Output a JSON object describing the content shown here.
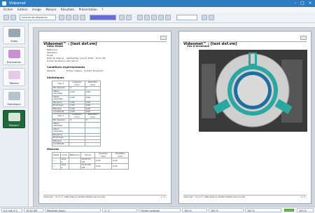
{
  "window": {
    "title": "Videomet"
  },
  "menu": [
    "Fichier",
    "Edition",
    "Image",
    "Mesure",
    "Résultats",
    "Présentation",
    "?"
  ],
  "toolbar": {
    "dropdown_left": "Lecture de séquence",
    "dropdown_mid": "",
    "dropdown_right": ""
  },
  "sidebar": [
    {
      "label": "Vidéo",
      "icon": "video-icon"
    },
    {
      "label": "Exploration",
      "icon": "exploration-icon"
    },
    {
      "label": "Tableau",
      "icon": "table-icon"
    },
    {
      "label": "Statistique",
      "icon": "statistics-icon"
    },
    {
      "label": "Rapport",
      "icon": "report-icon",
      "active": true
    }
  ],
  "page1": {
    "title": "Videomet™ : [test dxf.vm]",
    "info_title": "Infos étude",
    "info": [
      {
        "k": "Référence",
        "v": ""
      },
      {
        "k": "Opérateur",
        "v": ""
      },
      {
        "k": "Projet",
        "v": ""
      },
      {
        "k": "Date de mesure",
        "v": "Wednesday, June 8, 2016 - 10:01 AM"
      },
      {
        "k": "Fichier de Mesure",
        "v": "test dxf.vm"
      }
    ],
    "conditions_title": "Conditions expérimentales",
    "conditions": [
      {
        "k": "Objectif",
        "v": "Fichier original - (1.0427 Pixel/unit)"
      }
    ],
    "stats_title": "Statistiques",
    "stats_table1": {
      "headers": [
        "Ypos 1",
        "Longueur (mm)",
        "Diamètre (mm)"
      ],
      "rows": [
        [
          "Nb mesures",
          "5",
          "3"
        ],
        [
          "Valeur minimale",
          "0.00",
          "0.00"
        ],
        [
          "Valeur maximale",
          "0.00",
          "0.00"
        ],
        [
          "Moyenne",
          "0.00",
          "0.00"
        ],
        [
          "Écart-type",
          "0.00",
          "0.00"
        ],
        [
          "Étendue",
          "0.00",
          "0.00"
        ],
        [
          "Incertitude",
          "0.00",
          "0.00"
        ]
      ]
    },
    "stats_table2": {
      "headers": [
        "Ypos 1",
        "Longueur (mm)",
        "Diamètre (mm)"
      ],
      "rows": [
        [
          "Nb mesures",
          "0",
          "0"
        ],
        [
          "Valeur minimale",
          "",
          ""
        ],
        [
          "Valeur maximale",
          "",
          ""
        ],
        [
          "Moyenne",
          "",
          ""
        ],
        [
          "Écart-type",
          "",
          ""
        ],
        [
          "Étendue",
          "",
          ""
        ],
        [
          "Incertitude",
          "",
          ""
        ]
      ]
    },
    "mesures_title": "Mesures",
    "mesures_table": {
      "headers": [
        "Statut",
        "Code",
        "Référence",
        "Heure",
        "Longueur (mm)",
        "Diamètre (mm)"
      ],
      "rows": [
        [
          "✓",
          "Ypos 1",
          "",
          "10:42:31 AM",
          "0.00",
          "0.00"
        ],
        [
          "✓",
          "Ypos 1",
          "",
          "10:42:36 AM",
          "0.00",
          "0.00"
        ]
      ]
    },
    "footer_left": "Videomet™ V1.0 (© 1996-2016 by MICRO-VISION Instruments)",
    "footer_right": "- 1 / 2 -"
  },
  "page2": {
    "title": "Videomet™ : [test dxf.vm]",
    "section": "Vue d'ensemble",
    "footer_left": "Videomet™ V1.0 (© 1996-2016 by MICRO-VISION Instruments)",
    "footer_right": "- 2 / 2 -"
  },
  "status": {
    "coords": "0.0 mm X 0",
    "time": "10:42 AM",
    "mode": "Résultats Zoom",
    "page": "1 / 1",
    "file": "Fichier (original)",
    "zoom_pct": "100 %",
    "zoom2": "100 %",
    "percent": "100 %",
    "zoom_level": 1.0
  },
  "colors": {
    "accent": "#2d7cc1",
    "active_sidebar": "#1f6a3a",
    "teal_part": "#2aa7a0"
  }
}
